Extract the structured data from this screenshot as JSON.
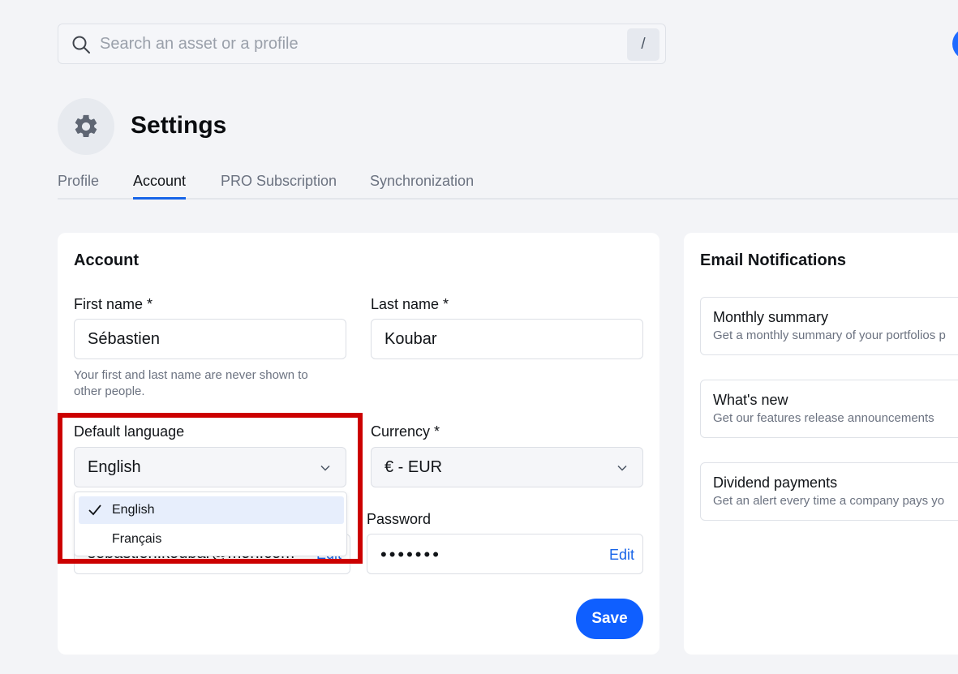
{
  "search": {
    "placeholder": "Search an asset or a profile",
    "shortcut": "/"
  },
  "header": {
    "title": "Settings"
  },
  "tabs": [
    {
      "label": "Profile"
    },
    {
      "label": "Account"
    },
    {
      "label": "PRO Subscription"
    },
    {
      "label": "Synchronization"
    }
  ],
  "account": {
    "title": "Account",
    "first_name_label": "First name *",
    "first_name_value": "Sébastien",
    "last_name_label": "Last name *",
    "last_name_value": "Koubar",
    "help_line1": "Your first and last name are never shown to",
    "help_line2": "other people.",
    "language_label": "Default language",
    "language_value": "English",
    "currency_label": "Currency *",
    "currency_value": "€ - EUR",
    "language_options": [
      {
        "label": "English",
        "selected": true
      },
      {
        "label": "Français",
        "selected": false
      }
    ],
    "email_value": "sebastien.koubar@mon.com",
    "email_edit": "Edit",
    "password_label": "Password",
    "password_value": "•••••••",
    "password_edit": "Edit",
    "save_label": "Save"
  },
  "notifications": {
    "title": "Email Notifications",
    "items": [
      {
        "title": "Monthly summary",
        "desc": "Get a monthly summary of your portfolios p"
      },
      {
        "title": "What's new",
        "desc": "Get our features release announcements"
      },
      {
        "title": "Dividend payments",
        "desc": "Get an alert every time a company pays yo"
      }
    ]
  },
  "colors": {
    "accent": "#1764e8",
    "highlight": "#cc0000",
    "save_button": "#0f5fff"
  }
}
